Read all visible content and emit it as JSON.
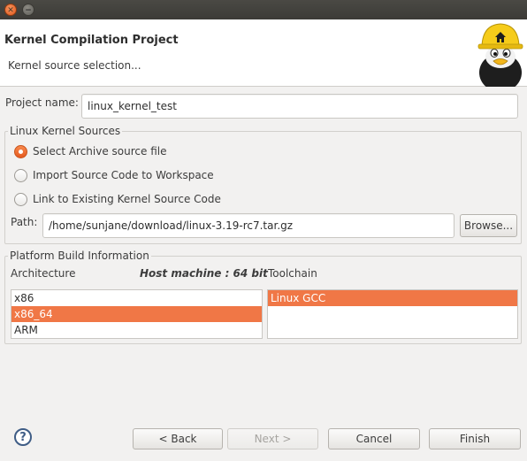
{
  "window": {
    "close_glyph": "✕",
    "minimize_glyph": "−"
  },
  "header": {
    "title": "Kernel Compilation Project",
    "subtitle": "Kernel source selection..."
  },
  "project": {
    "label": "Project name:",
    "value": "linux_kernel_test"
  },
  "sources": {
    "group_title": "Linux Kernel Sources",
    "options": [
      {
        "label": "Select Archive source file",
        "checked": true
      },
      {
        "label": "Import Source Code to Workspace",
        "checked": false
      },
      {
        "label": "Link to Existing Kernel Source Code",
        "checked": false
      }
    ],
    "path_label": "Path:",
    "path_value": "/home/sunjane/download/linux-3.19-rc7.tar.gz",
    "browse_label": "Browse..."
  },
  "platform": {
    "group_title": "Platform  Build Information",
    "architecture_label": "Architecture",
    "host_machine": "Host machine : 64 bit",
    "toolchain_label": "Toolchain",
    "architectures": [
      {
        "label": "x86",
        "selected": false
      },
      {
        "label": "x86_64",
        "selected": true
      },
      {
        "label": "ARM",
        "selected": false
      }
    ],
    "toolchains": [
      {
        "label": "Linux GCC",
        "selected": true
      }
    ]
  },
  "footer": {
    "help_glyph": "?",
    "back_label": "< Back",
    "next_label": "Next >",
    "cancel_label": "Cancel",
    "finish_label": "Finish"
  },
  "colors": {
    "accent": "#f07746",
    "window_bg": "#f2f1f0",
    "titlebar": "#3c3b37"
  }
}
